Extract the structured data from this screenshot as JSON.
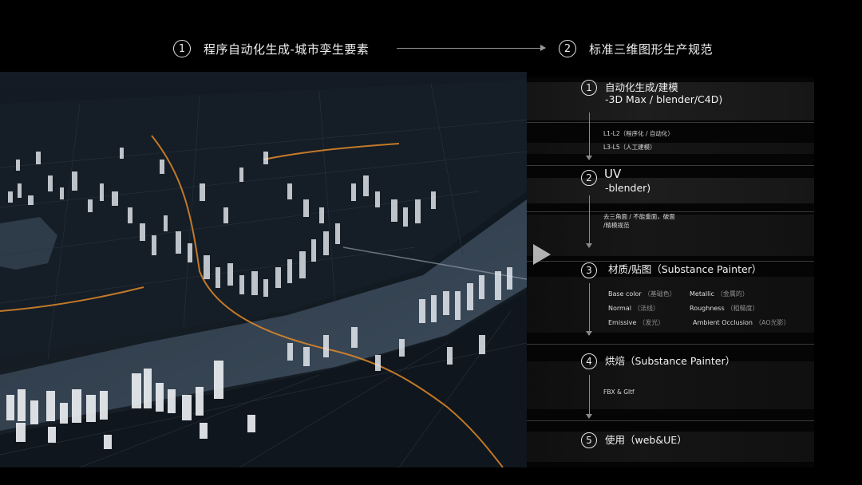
{
  "header": {
    "left_step": {
      "number": "1",
      "text": "程序自动化生成-城市孪生要素"
    },
    "right_step": {
      "number": "2",
      "text": "标准三维图形生产规范"
    }
  },
  "steps": [
    {
      "number": "1",
      "title": "自动化生成/建模",
      "subtitle": "-3D Max / blender/C4D)"
    },
    {
      "number": "2",
      "title": "UV",
      "subtitle": "-blender)"
    },
    {
      "number": "3",
      "title": "材质/贴图（Substance Painter）"
    },
    {
      "number": "4",
      "title": "烘焙（Substance Painter）"
    },
    {
      "number": "5",
      "title": "使用（web&UE）"
    }
  ],
  "notes": {
    "l1l2": "L1-L2（程序化 / 自动化）",
    "l3l5": "L3-L5（人工建模）",
    "uv_line1": "去三角面 / 不能重面，破面",
    "uv_line2": "/精模规范",
    "export": "FBX & Gltf"
  },
  "materials": [
    {
      "en": "Base color",
      "cn": "（基础色）"
    },
    {
      "en": "Metallic",
      "cn": "（金属的）"
    },
    {
      "en": "Normal",
      "cn": "（法线）"
    },
    {
      "en": "Roughness",
      "cn": "（粗糙度）"
    },
    {
      "en": "Emissive",
      "cn": "（发光）"
    },
    {
      "en": "Ambient Occlusion",
      "cn": "（AO光影）"
    }
  ],
  "colors": {
    "background": "#000000",
    "road_glow": "#e08a2a",
    "building_light": "#e9edf2",
    "river": "#3b4a5a"
  }
}
